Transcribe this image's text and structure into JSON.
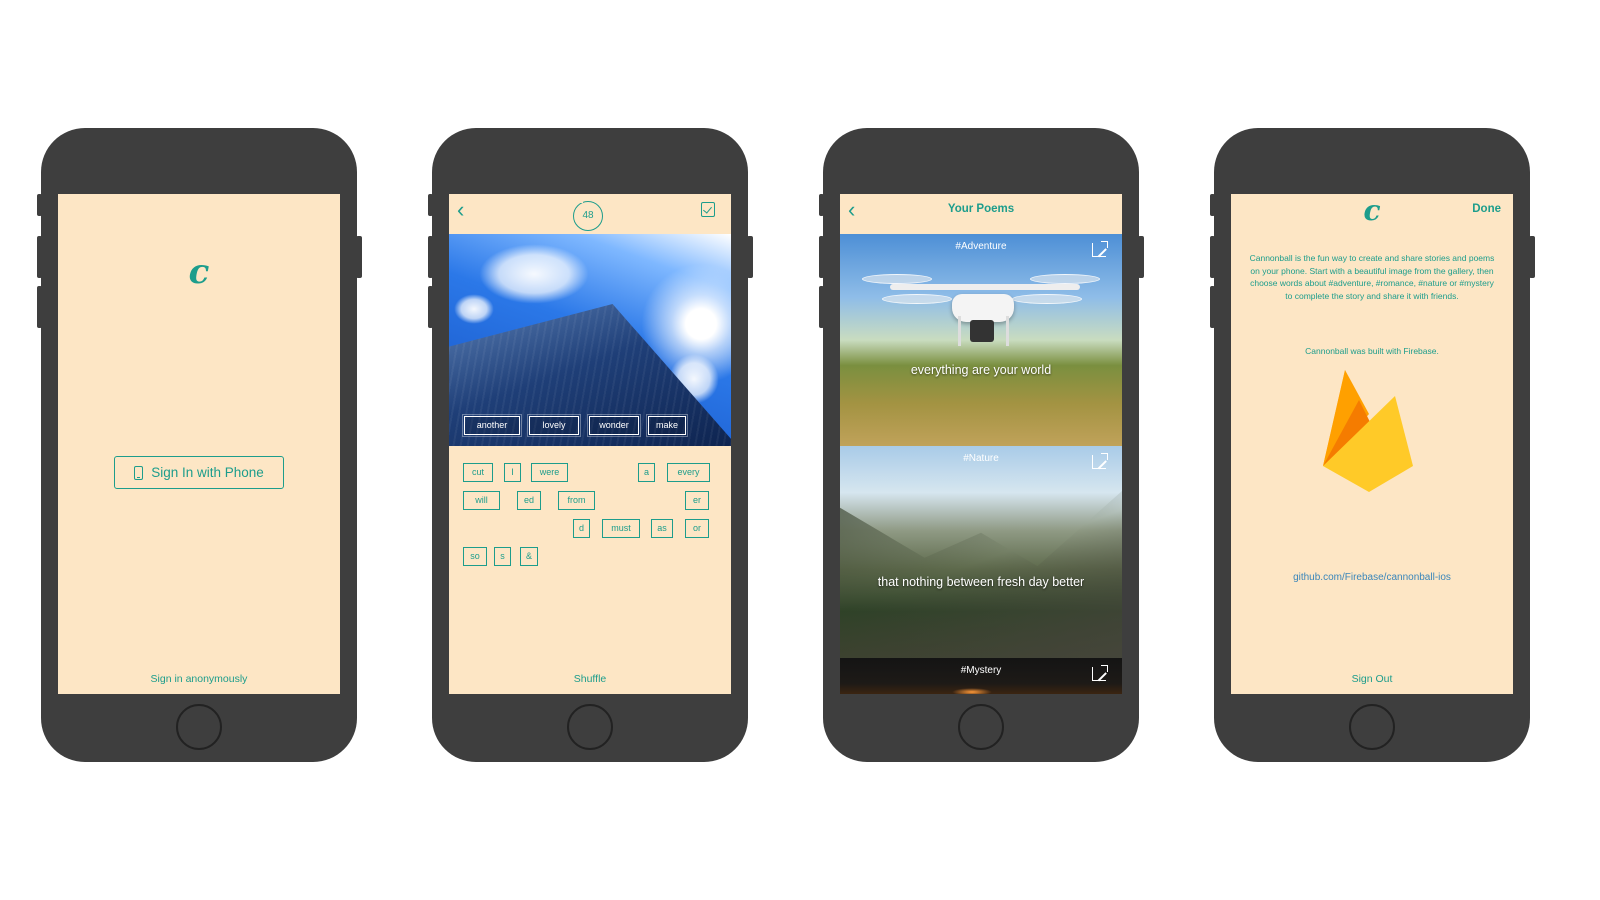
{
  "colors": {
    "accent": "#1d9d8c",
    "screen_bg": "#fde6c5",
    "phone_body": "#3e3e3e",
    "link": "#3a86ba"
  },
  "phone1": {
    "logo": "c",
    "signin_label": "Sign In with Phone",
    "signin_icon": "phone-icon",
    "anon_label": "Sign in anonymously"
  },
  "phone2": {
    "back_icon": "chevron-left-icon",
    "timer": "48",
    "doc_icon": "document-check-icon",
    "photo_words": [
      "another",
      "lovely",
      "wonder",
      "make"
    ],
    "tray_words": [
      "cut",
      "I",
      "were",
      "a",
      "every",
      "will",
      "ed",
      "from",
      "er",
      "d",
      "must",
      "as",
      "or",
      "so",
      "s",
      "&"
    ],
    "shuffle_label": "Shuffle"
  },
  "phone3": {
    "back_icon": "chevron-left-icon",
    "title": "Your Poems",
    "share_icon": "share-icon",
    "poems": [
      {
        "tag": "#Adventure",
        "text": "everything are your world"
      },
      {
        "tag": "#Nature",
        "text": "that nothing between fresh day better"
      },
      {
        "tag": "#Mystery",
        "text": ""
      }
    ]
  },
  "phone4": {
    "logo": "c",
    "done_label": "Done",
    "description": "Cannonball is the fun way to create and share stories and poems on your phone. Start with a beautiful image from the gallery, then choose words about #adventure, #romance, #nature or #mystery to complete the story and share it with friends.",
    "built_with": "Cannonball was built with Firebase.",
    "firebase_icon": "firebase-logo-icon",
    "link": "github.com/Firebase/cannonball-ios",
    "signout_label": "Sign Out"
  }
}
